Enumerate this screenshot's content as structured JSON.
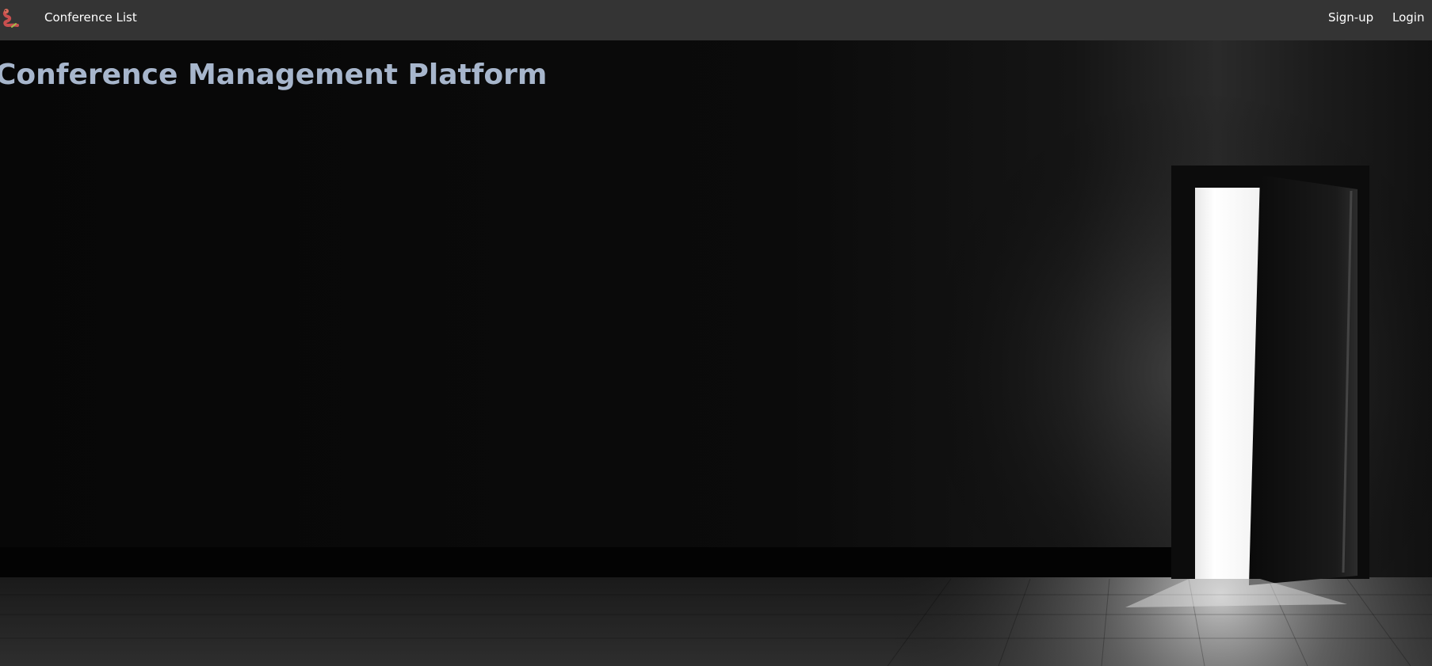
{
  "navbar": {
    "logo_icon": "worm-mascot-icon",
    "links": {
      "conference_list": "Conference List",
      "signup": "Sign-up",
      "login": "Login"
    }
  },
  "main": {
    "title": "Conference Management Platform"
  },
  "hero": {
    "background": "dark-room-open-door-image"
  },
  "colors": {
    "navbar_bg": "#343434",
    "nav_text": "#ffffff",
    "title": "#a7b6cc",
    "background": "#050505"
  }
}
